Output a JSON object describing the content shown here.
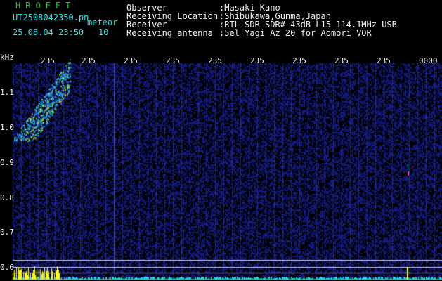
{
  "app": {
    "title": "HROFFT",
    "filename": "UT2508042350.pn",
    "filename_suffix": "meteor",
    "datetime": "25.08.04 23:50",
    "interval": "10"
  },
  "info": {
    "labels": [
      "Observer",
      "Receiving Location",
      "Receiver",
      "Receiving antenna"
    ],
    "values": [
      ":Masaki Kano",
      ":Shibukawa,Gunma,Japan",
      ":RTL-SDR SDR# 43dB L15 114.1MHz USB",
      ":5el Yagi Az 20 for Aomori VOR"
    ]
  },
  "axes": {
    "y_unit": "kHz",
    "y_ticks": [
      "1.1",
      "1.0",
      "0.9",
      "0.8",
      "0.7",
      "0.6"
    ],
    "x_ticks": [
      "235",
      "235",
      "235",
      "235",
      "235",
      "235",
      "235",
      "235",
      "235",
      "0000"
    ]
  },
  "colors": {
    "background": "#000000",
    "noise": "#1a1f7a",
    "meteor": "#2fe0e0",
    "hot": "#ffff00",
    "baseline": "#19d6e6",
    "grid_line": "#c8c8ff"
  }
}
